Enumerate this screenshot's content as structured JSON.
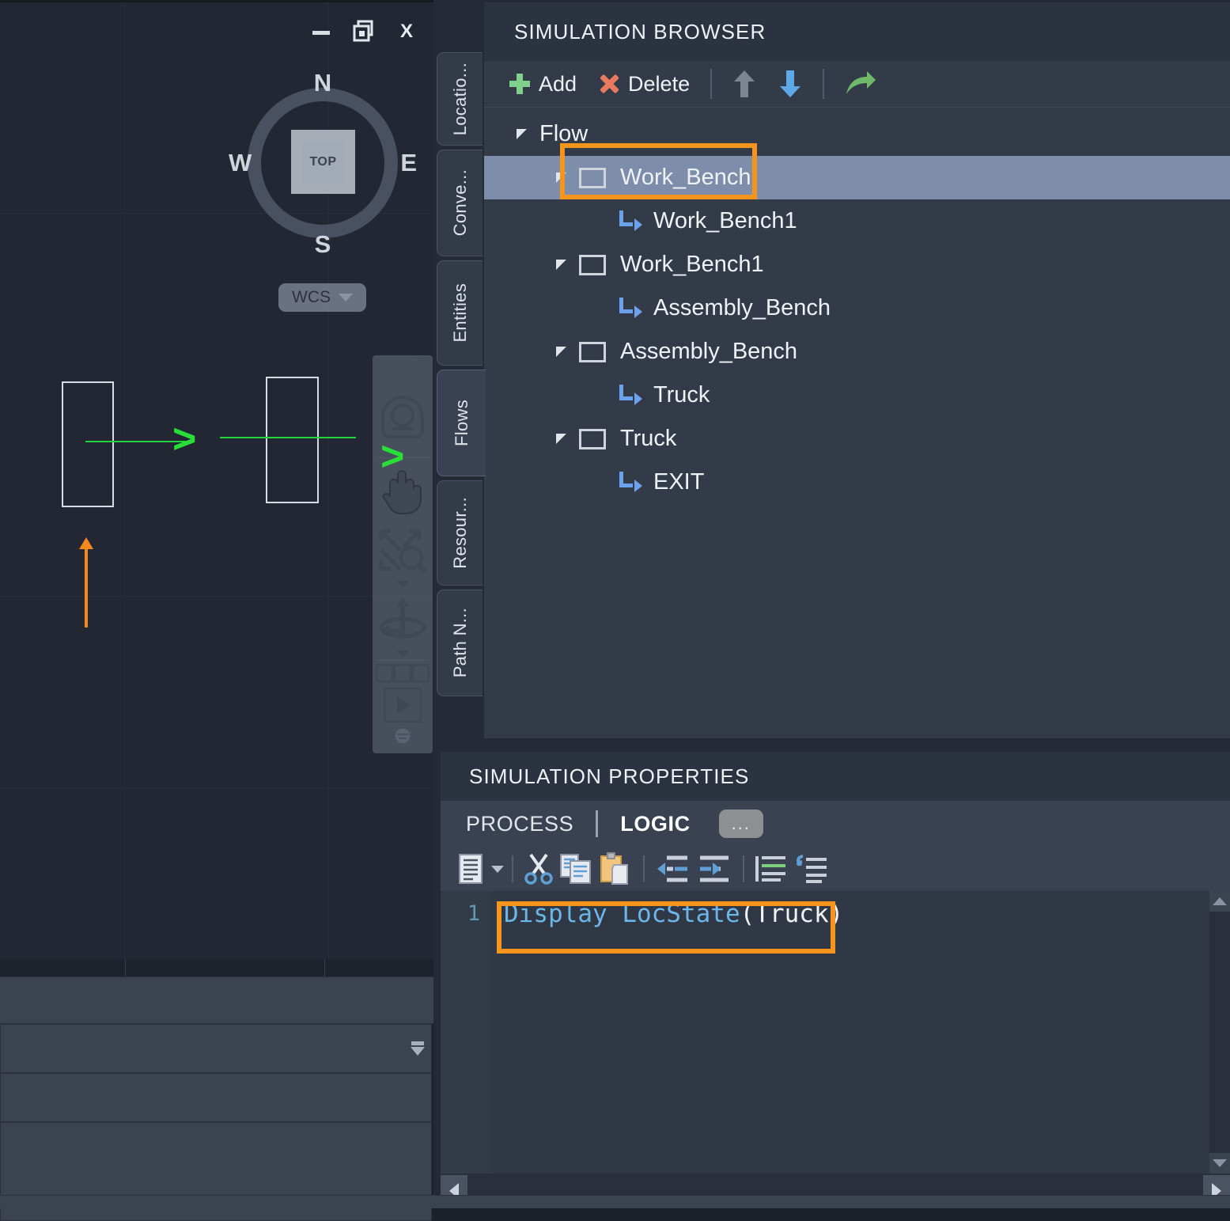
{
  "viewport": {
    "window_controls": [
      "minimize",
      "restore",
      "close"
    ],
    "compass": {
      "north": "N",
      "south": "S",
      "west": "W",
      "east": "E",
      "cube_label": "TOP"
    },
    "coordinate_system": {
      "label": "WCS"
    },
    "navbar_items": [
      "steering-wheel-icon",
      "pan-hand-icon",
      "zoom-icon",
      "orbit-icon",
      "views-icon",
      "play-icon"
    ]
  },
  "sidetabs": [
    {
      "label": "Locatio...",
      "active": false
    },
    {
      "label": "Conve...",
      "active": false
    },
    {
      "label": "Entities",
      "active": false
    },
    {
      "label": "Flows",
      "active": true
    },
    {
      "label": "Resour...",
      "active": false
    },
    {
      "label": "Path N...",
      "active": false
    }
  ],
  "browser": {
    "title": "SIMULATION BROWSER",
    "toolbar": {
      "add_label": "Add",
      "delete_label": "Delete",
      "move_up_icon": "arrow-up-icon",
      "move_down_icon": "arrow-down-icon",
      "share_icon": "forward-arrow-icon"
    },
    "tree": [
      {
        "label": "Flow",
        "depth": 0,
        "caret": true,
        "icon": "none",
        "selected": false
      },
      {
        "label": "Work_Bench",
        "depth": 1,
        "caret": true,
        "icon": "location",
        "selected": true
      },
      {
        "label": "Work_Bench1",
        "depth": 2,
        "caret": false,
        "icon": "route",
        "selected": false
      },
      {
        "label": "Work_Bench1",
        "depth": 1,
        "caret": true,
        "icon": "location",
        "selected": false
      },
      {
        "label": "Assembly_Bench",
        "depth": 2,
        "caret": false,
        "icon": "route",
        "selected": false
      },
      {
        "label": "Assembly_Bench",
        "depth": 1,
        "caret": true,
        "icon": "location",
        "selected": false
      },
      {
        "label": "Truck",
        "depth": 2,
        "caret": false,
        "icon": "route",
        "selected": false
      },
      {
        "label": "Truck",
        "depth": 1,
        "caret": true,
        "icon": "location",
        "selected": false
      },
      {
        "label": "EXIT",
        "depth": 2,
        "caret": false,
        "icon": "route",
        "selected": false
      }
    ]
  },
  "properties": {
    "title": "SIMULATION PROPERTIES",
    "tabs": [
      {
        "label": "PROCESS",
        "active": false
      },
      {
        "label": "LOGIC",
        "active": true
      }
    ],
    "more_label": "...",
    "code_toolbar": [
      "insert-statement-icon",
      "dropdown-caret-icon",
      "cut-icon",
      "copy-icon",
      "paste-icon",
      "outdent-icon",
      "indent-icon",
      "comment-icon",
      "uncomment-icon"
    ],
    "editor": {
      "lines": [
        {
          "number": "1",
          "tokens": [
            {
              "text": "Display ",
              "type": "keyword"
            },
            {
              "text": "LocState",
              "type": "function"
            },
            {
              "text": "(Truck)",
              "type": "plain"
            }
          ],
          "plain": "Display LocState(Truck)"
        }
      ]
    }
  },
  "highlights": {
    "accent_color": "#f7941d",
    "items": [
      "tree-node-work-bench",
      "code-line-1"
    ]
  },
  "colors": {
    "panel_bg": "#333b49",
    "header_bg": "#2c3340",
    "viewport_bg": "#222733",
    "selection_bg": "#7e8eaa",
    "editor_bg": "#303846",
    "accent_orange": "#f7941d",
    "green": "#2ade38",
    "link_blue": "#6ba2ee",
    "code_blue": "#6cb6e8"
  }
}
